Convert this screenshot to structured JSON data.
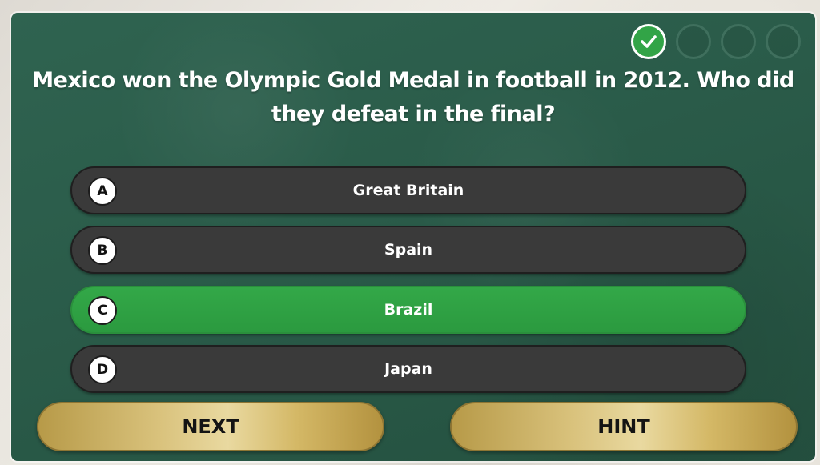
{
  "question": {
    "text": "Mexico won the Olympic Gold Medal in football in 2012. Who did they defeat in the final?"
  },
  "progress": [
    {
      "state": "completed",
      "icon": "check-icon"
    },
    {
      "state": "pending"
    },
    {
      "state": "pending"
    },
    {
      "state": "pending"
    }
  ],
  "answers": [
    {
      "letter": "A",
      "text": "Great Britain",
      "state": "default"
    },
    {
      "letter": "B",
      "text": "Spain",
      "state": "default"
    },
    {
      "letter": "C",
      "text": "Brazil",
      "state": "correct"
    },
    {
      "letter": "D",
      "text": "Japan",
      "state": "default"
    }
  ],
  "buttons": {
    "next_label": "NEXT",
    "hint_label": "HINT"
  },
  "colors": {
    "panel_green": "#2a5b49",
    "correct_green": "#2f9f44",
    "answer_dark": "#3a3a3a",
    "gold": "#d9c27c"
  }
}
